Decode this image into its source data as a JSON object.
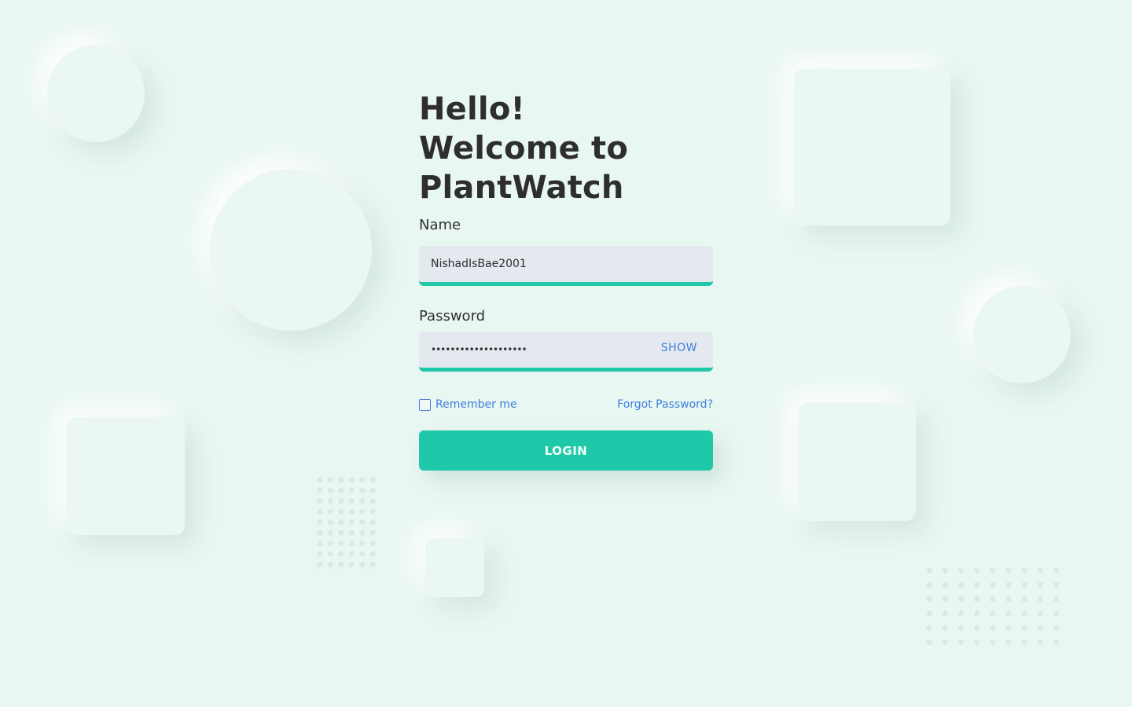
{
  "heading": {
    "line1": "Hello!",
    "line2": "Welcome to",
    "line3": "PlantWatch"
  },
  "name_field": {
    "label": "Name",
    "value": "NishadIsBae2001"
  },
  "password_field": {
    "label": "Password",
    "masked_value": "••••••••••••••••••••",
    "show_label": "SHOW"
  },
  "remember": {
    "label": "Remember me",
    "checked": false
  },
  "forgot_label": "Forgot Password?",
  "login_label": "LOGIN",
  "colors": {
    "background": "#e9f7f2",
    "accent": "#1ec8a8",
    "link": "#3c7fde",
    "input_bg": "#e4e8ef",
    "text": "#2e2e2e"
  }
}
